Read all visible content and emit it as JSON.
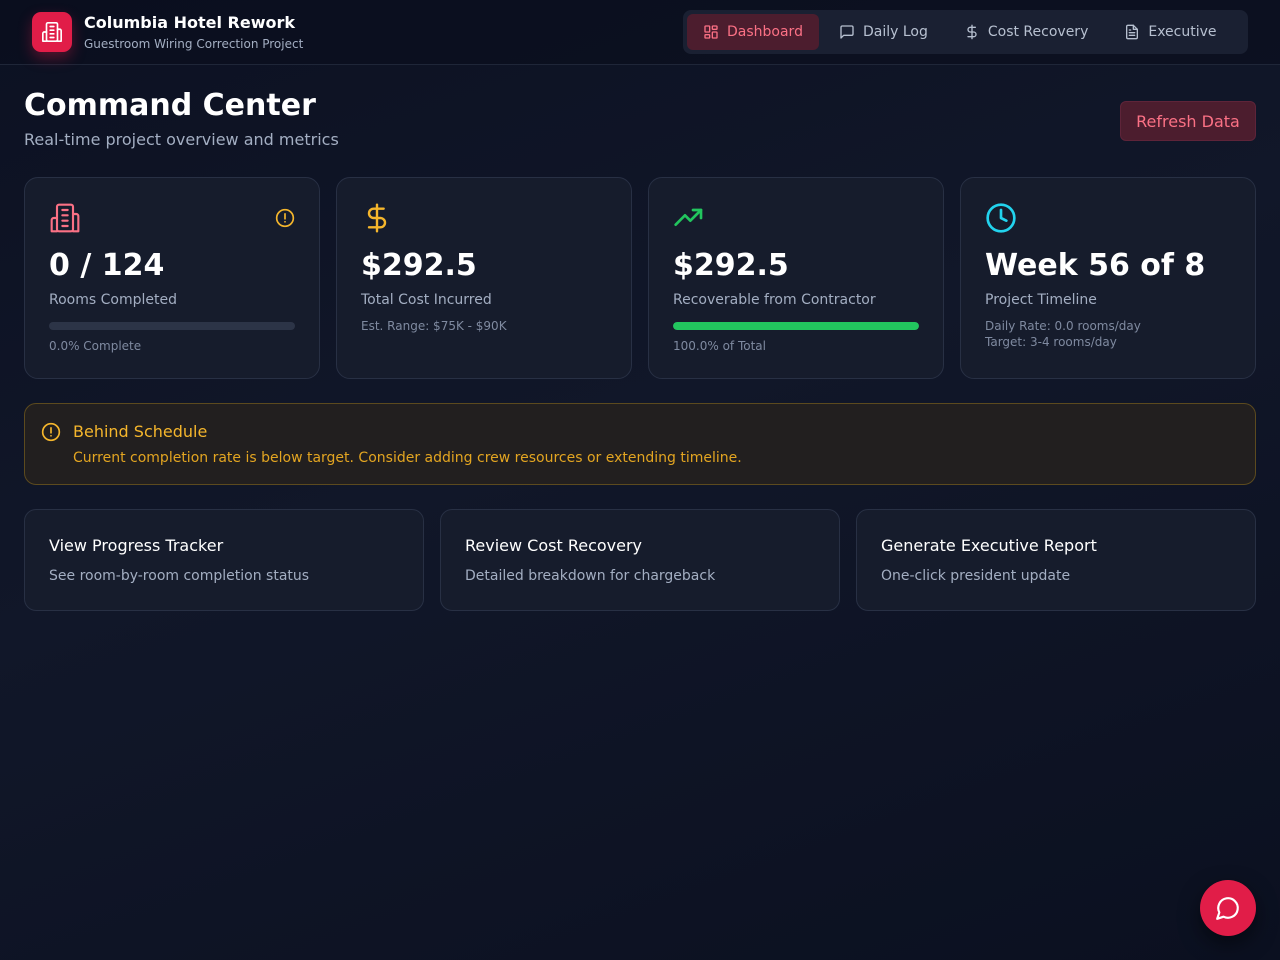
{
  "app": {
    "title": "Columbia Hotel Rework",
    "subtitle": "Guestroom Wiring Correction Project"
  },
  "nav": {
    "items": [
      {
        "label": "Dashboard",
        "icon": "dashboard-icon",
        "active": true
      },
      {
        "label": "Daily Log",
        "icon": "chat-icon",
        "active": false
      },
      {
        "label": "Cost Recovery",
        "icon": "dollar-icon",
        "active": false
      },
      {
        "label": "Executive",
        "icon": "document-icon",
        "active": false
      }
    ]
  },
  "header": {
    "title": "Command Center",
    "subtitle": "Real-time project overview and metrics",
    "refresh_label": "Refresh Data"
  },
  "stats": {
    "rooms": {
      "value": "0 / 124",
      "label": "Rooms Completed",
      "note": "0.0% Complete",
      "progress": 0.0,
      "icon": "building-icon",
      "alert_icon": "alert-circle-icon"
    },
    "cost": {
      "value": "$292.5",
      "label": "Total Cost Incurred",
      "note": "Est. Range: $75K - $90K",
      "icon": "dollar-icon"
    },
    "recoverable": {
      "value": "$292.5",
      "label": "Recoverable from Contractor",
      "note": "100.0% of Total",
      "progress": 1.0,
      "icon": "trending-up-icon"
    },
    "timeline": {
      "value": "Week 56 of 8",
      "label": "Project Timeline",
      "note1": "Daily Rate: 0.0 rooms/day",
      "note2": "Target: 3-4 rooms/day",
      "icon": "clock-icon"
    }
  },
  "alert": {
    "title": "Behind Schedule",
    "text": "Current completion rate is below target. Consider adding crew resources or extending timeline.",
    "icon": "alert-circle-icon"
  },
  "actions": [
    {
      "title": "View Progress Tracker",
      "desc": "See room-by-room completion status"
    },
    {
      "title": "Review Cost Recovery",
      "desc": "Detailed breakdown for chargeback"
    },
    {
      "title": "Generate Executive Report",
      "desc": "One-click president update"
    }
  ],
  "colors": {
    "accent": "#e11d48",
    "warning": "#f5b62c",
    "success": "#22c55e",
    "info": "#22d3ee"
  }
}
